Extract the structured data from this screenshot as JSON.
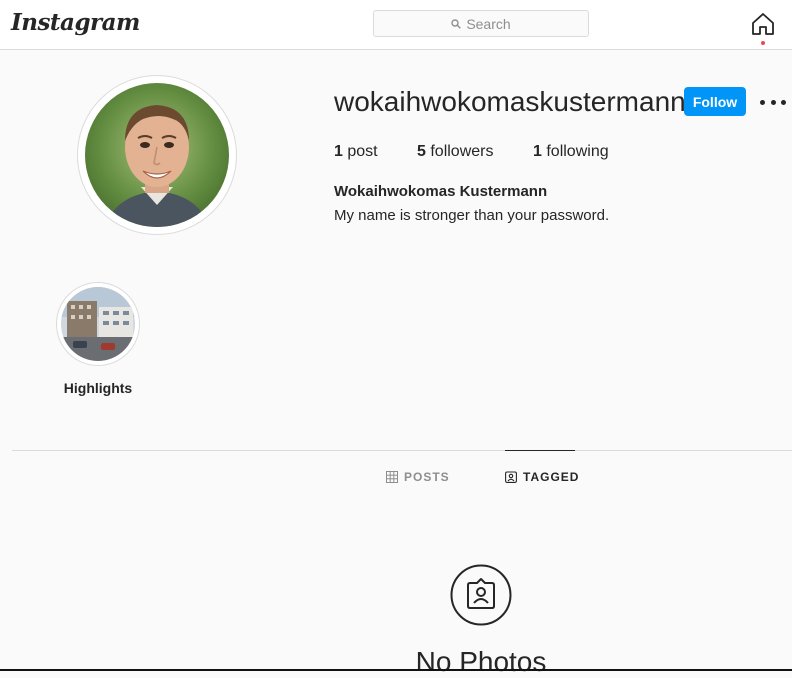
{
  "app": {
    "logo_text": "Instagram",
    "search_placeholder": "Search"
  },
  "profile": {
    "username": "wokaihwokomaskustermann",
    "follow_label": "Follow",
    "stats": {
      "posts_count": "1",
      "posts_label": " post",
      "followers_count": "5",
      "followers_label": " followers",
      "following_count": "1",
      "following_label": " following"
    },
    "full_name": "Wokaihwokomas Kustermann",
    "bio": "My name is stronger than your password."
  },
  "highlights": [
    {
      "label": "Highlights"
    }
  ],
  "tabs": [
    {
      "label": "POSTS",
      "icon": "grid-icon",
      "active": false
    },
    {
      "label": "TAGGED",
      "icon": "tagged-icon",
      "active": true
    }
  ],
  "empty_state": {
    "title": "No Photos"
  },
  "colors": {
    "accent": "#0095f6",
    "background": "#fafafa",
    "border": "#dbdbdb",
    "notification": "#ed4956"
  }
}
